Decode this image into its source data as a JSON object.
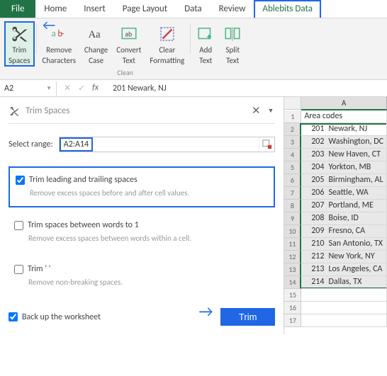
{
  "menu": {
    "file": "File",
    "tabs": [
      "Home",
      "Insert",
      "Page Layout",
      "Data",
      "Review",
      "Ablebits Data"
    ],
    "active_index": 5
  },
  "ribbon": {
    "buttons": [
      {
        "label": "Trim\nSpaces",
        "icon": "scissors"
      },
      {
        "label": "Remove\nCharacters",
        "icon": "remove-chars"
      },
      {
        "label": "Change\nCase",
        "icon": "change-case"
      },
      {
        "label": "Convert\nText",
        "icon": "convert-text"
      },
      {
        "label": "Clear\nFormatting",
        "icon": "clear-format"
      },
      {
        "label": "Add\nText",
        "icon": "add-text"
      },
      {
        "label": "Split\nText",
        "icon": "split-text"
      }
    ],
    "group_label": "Clean"
  },
  "formula_bar": {
    "name_box": "A2",
    "value": "201     Newark, NJ"
  },
  "task_pane": {
    "title": "Trim Spaces",
    "range_label": "Select range:",
    "range_value": "A2:A14",
    "options": [
      {
        "label": "Trim leading and trailing spaces",
        "desc": "Remove excess spaces before and after cell values.",
        "checked": true
      },
      {
        "label": "Trim spaces between words to 1",
        "desc": "Remove excess spaces between words within a cell.",
        "checked": false
      },
      {
        "label": "Trim '&nbsp;'",
        "desc": "Remove non-breaking spaces.",
        "checked": false
      }
    ],
    "backup_label": "Back up the worksheet",
    "backup_checked": true,
    "trim_button": "Trim"
  },
  "grid": {
    "column": "A",
    "header": "Area codes",
    "rows": [
      {
        "n": 1,
        "text": "Area codes",
        "is_header": true
      },
      {
        "n": 2,
        "code": "201",
        "city": "Newark, NJ"
      },
      {
        "n": 3,
        "code": "202",
        "city": "Washington, DC"
      },
      {
        "n": 4,
        "code": "203",
        "city": "New Haven, CT"
      },
      {
        "n": 5,
        "code": "204",
        "city": "Yorkton, MB"
      },
      {
        "n": 6,
        "code": "205",
        "city": "Birmingham, AL"
      },
      {
        "n": 7,
        "code": "206",
        "city": "Seattle, WA"
      },
      {
        "n": 8,
        "code": "207",
        "city": "Portland, ME"
      },
      {
        "n": 9,
        "code": "208",
        "city": "Boise, ID"
      },
      {
        "n": 10,
        "code": "209",
        "city": "Fresno, CA"
      },
      {
        "n": 11,
        "code": "210",
        "city": "San Antonio, TX"
      },
      {
        "n": 12,
        "code": "212",
        "city": "New York, NY"
      },
      {
        "n": 13,
        "code": "213",
        "city": "Los Angeles, CA"
      },
      {
        "n": 14,
        "code": "214",
        "city": "Dallas, TX"
      },
      {
        "n": 15,
        "text": ""
      },
      {
        "n": 16,
        "text": ""
      },
      {
        "n": 17,
        "text": ""
      }
    ],
    "selection": {
      "start": 2,
      "end": 14
    }
  }
}
